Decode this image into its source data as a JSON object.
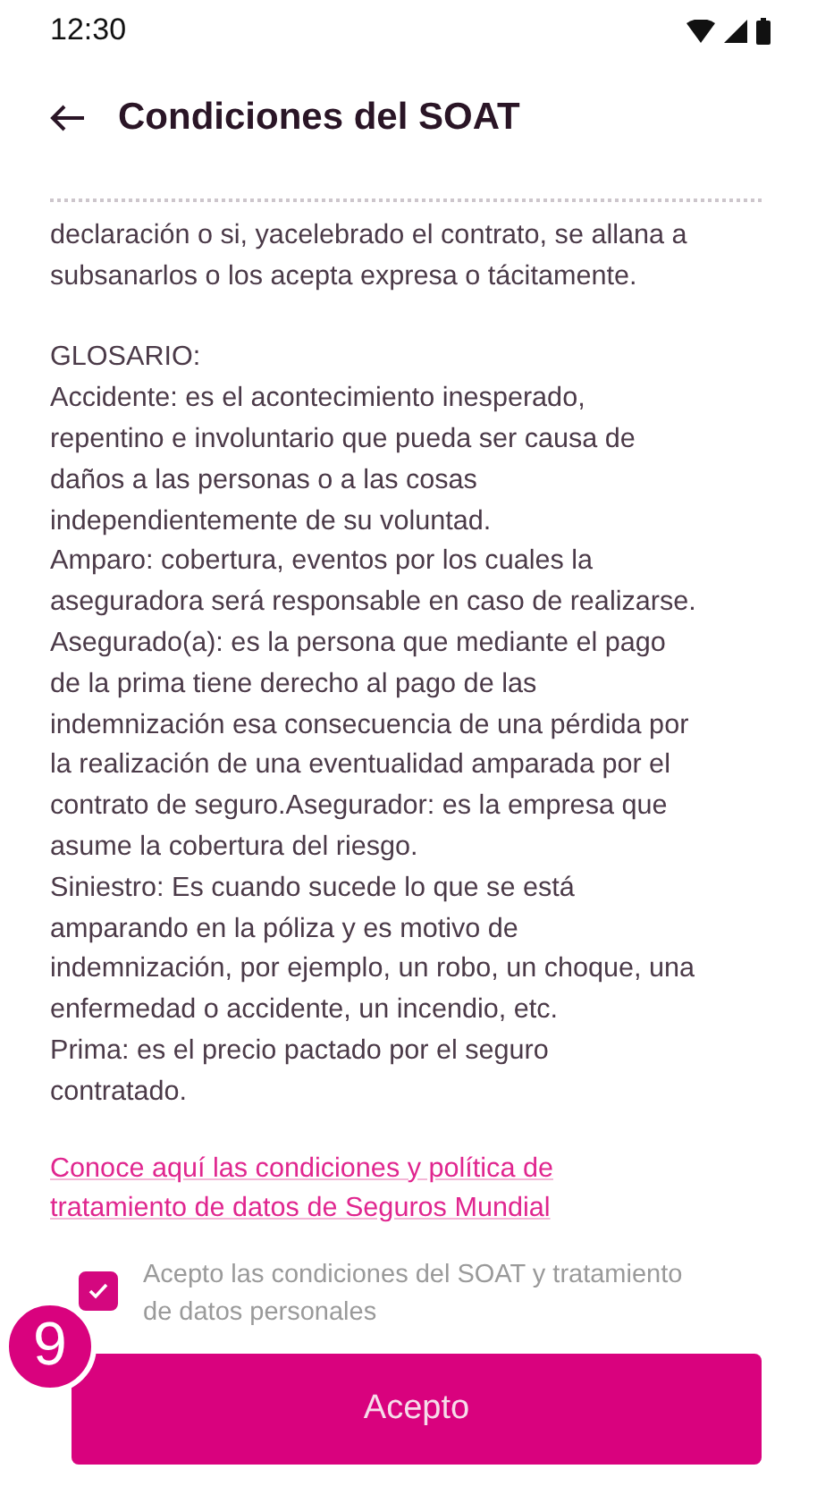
{
  "status_bar": {
    "time": "12:30"
  },
  "header": {
    "title": "Condiciones del SOAT"
  },
  "body_paragraphs": [
    [
      "declaración o si, yacelebrado el contrato, se allana a",
      "subsanarlos o los acepta expresa o tácitamente."
    ],
    [
      "GLOSARIO:",
      "Accidente: es el acontecimiento inesperado,",
      "repentino e involuntario que pueda ser causa de",
      "daños a las personas o a las cosas",
      "independientemente de su voluntad.",
      "Amparo: cobertura, eventos por los cuales la",
      "aseguradora será responsable en caso de realizarse.",
      "Asegurado(a): es la persona que mediante el pago",
      "de la prima tiene derecho al pago de las",
      "indemnización esa consecuencia de una pérdida por",
      "la realización de una eventualidad amparada por el",
      "contrato de seguro.Asegurador: es la empresa que",
      "asume la cobertura del riesgo.",
      "Siniestro: Es cuando sucede lo que se está",
      "amparando en la póliza y es motivo de",
      "indemnización, por ejemplo, un robo, un choque, una",
      "enfermedad o accidente, un incendio, etc.",
      "Prima: es el precio pactado por el seguro",
      "contratado."
    ]
  ],
  "link_lines": [
    "Conoce aquí las condiciones y política de",
    "tratamiento de datos de Seguros Mundial"
  ],
  "consent": {
    "checked": true,
    "label_lines": [
      "Acepto las condiciones del SOAT y tratamiento",
      "de datos personales"
    ]
  },
  "step_badge": "9",
  "button": {
    "label": "Acepto"
  }
}
